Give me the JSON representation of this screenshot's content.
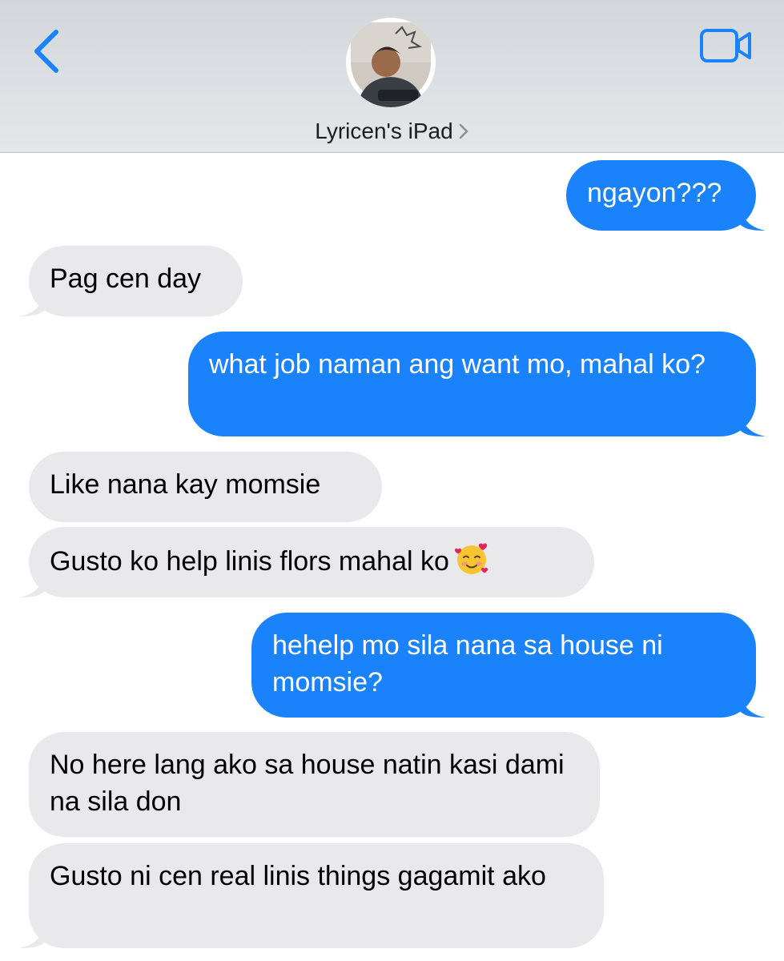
{
  "header": {
    "back_icon": "chevron-left-icon",
    "video_icon": "video-camera-icon",
    "contact_name": "Lyricen's iPad",
    "accent_color": "#1a82fb"
  },
  "messages": [
    {
      "direction": "sent",
      "text": "ngayon???"
    },
    {
      "direction": "received",
      "text": "Pag cen day"
    },
    {
      "direction": "sent",
      "text": "what job naman ang want mo, mahal ko?"
    },
    {
      "direction": "received",
      "text": "Like nana kay momsie"
    },
    {
      "direction": "received",
      "text": "Gusto ko help linis flors mahal ko",
      "emoji": "🥰"
    },
    {
      "direction": "sent",
      "text": "hehelp mo sila nana sa house ni momsie?"
    },
    {
      "direction": "received",
      "text": "No here lang ako sa house natin kasi dami na sila don"
    },
    {
      "direction": "received",
      "text": "Gusto ni cen real linis things gagamit ako"
    }
  ],
  "colors": {
    "sent_bubble": "#1a82fb",
    "received_bubble": "#e9e9eb"
  }
}
